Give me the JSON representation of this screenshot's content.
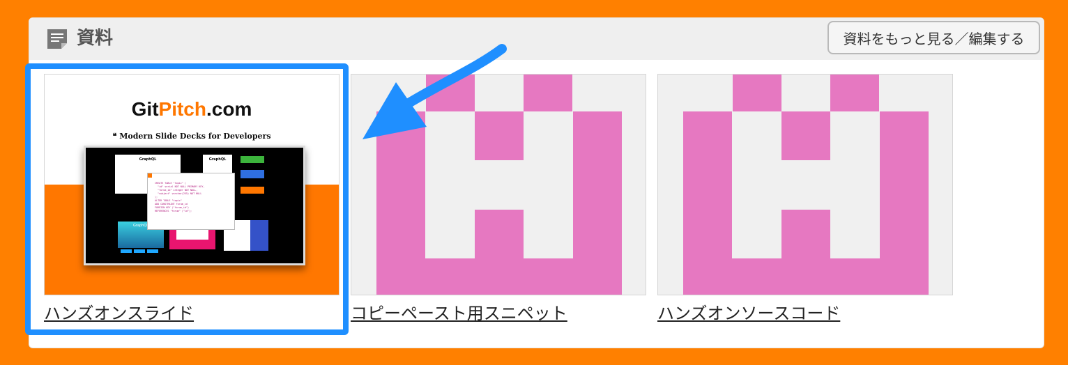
{
  "section": {
    "icon": "document-icon",
    "title": "資料",
    "more_button_label": "資料をもっと見る／編集する"
  },
  "cards": [
    {
      "title": "ハンズオンスライド",
      "thumbnail": {
        "logo_prefix": "Git",
        "logo_accent": "Pitch",
        "logo_suffix": ".com",
        "tagline": "❝ Modern Slide Decks for Developers",
        "slide_labels": [
          "GraphQL",
          "GraphQL",
          "GraphQL"
        ],
        "code_text": "CREATE TABLE \"topic\" (\n  \"id\" serial NOT NULL PRIMARY KEY,\n  \"forum_id\" integer NOT NULL,\n  \"subject\" varchar(255) NOT NULL\n);\nALTER TABLE \"topic\"\nADD CONSTRAINT forum_id\nFOREIGN KEY (\"forum_id\")\nREFERENCES \"forum\" (\"id\");"
      }
    },
    {
      "title": "コピーペースト用スニペット",
      "thumbnail": "pink-identicon"
    },
    {
      "title": "ハンズオンソースコード",
      "thumbnail": "pink-identicon"
    }
  ],
  "colors": {
    "background": "#ff8000",
    "accent_blue": "#1f8fff",
    "identicon_pink": "#e678c1",
    "identicon_bg": "#f0f0f0",
    "gitpitch_orange": "#ff7700"
  },
  "annotation": {
    "highlight": "selection-box",
    "arrow": "arrow-pointer"
  }
}
